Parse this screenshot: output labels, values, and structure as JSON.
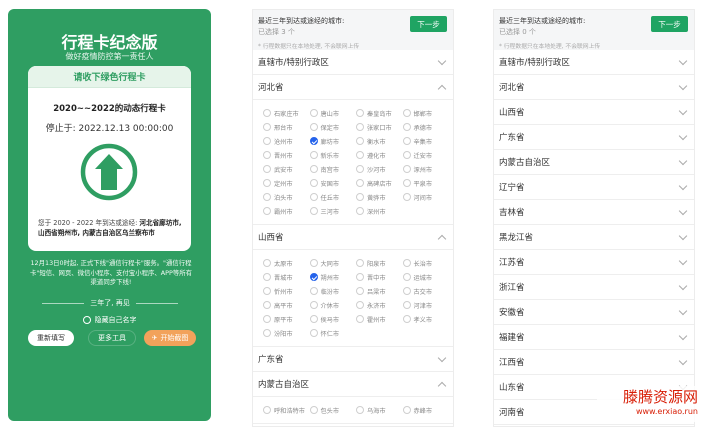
{
  "card": {
    "title": "行程卡纪念版",
    "subtitle": "做好疫情防控第一责任人",
    "inner_header": "请收下绿色行程卡",
    "inner_title": "2020~~2022的动态行程卡",
    "stop_text": "停止于: 2022.12.13 00:00:00",
    "info_prefix": "您于 2020 - 2022 年到达或途经: ",
    "info_places": "河北省廊坊市, 山西省朔州市, 内蒙古自治区乌兰察布市",
    "notice": "12月13日0时起, 正式下线\"通信行程卡\"服务。\"通信行程卡\"短信、网页、微信小程序、支付宝小程序、APP等所有渠道同步下线!",
    "divider": "三年了, 再见",
    "hide_name": "隐藏自己名字",
    "btn_rewrite": "重新填写",
    "btn_more": "更多工具",
    "btn_start": "开始截图",
    "accent": "#2f9e62"
  },
  "panel1": {
    "title": "最近三年到达或途经的城市:",
    "count": "已选择 3 个",
    "next": "下一步",
    "hint": "* 行程数据只在本地处理, 不会联网上传",
    "rows": [
      {
        "label": "直辖市/特别行政区",
        "open": false
      },
      {
        "label": "河北省",
        "open": true,
        "cities": [
          {
            "name": "石家庄市",
            "checked": false
          },
          {
            "name": "唐山市",
            "checked": false
          },
          {
            "name": "秦皇岛市",
            "checked": false
          },
          {
            "name": "邯郸市",
            "checked": false
          },
          {
            "name": "邢台市",
            "checked": false
          },
          {
            "name": "保定市",
            "checked": false
          },
          {
            "name": "张家口市",
            "checked": false
          },
          {
            "name": "承德市",
            "checked": false
          },
          {
            "name": "沧州市",
            "checked": false
          },
          {
            "name": "廊坊市",
            "checked": true
          },
          {
            "name": "衡水市",
            "checked": false
          },
          {
            "name": "辛集市",
            "checked": false
          },
          {
            "name": "晋州市",
            "checked": false
          },
          {
            "name": "新乐市",
            "checked": false
          },
          {
            "name": "遵化市",
            "checked": false
          },
          {
            "name": "迁安市",
            "checked": false
          },
          {
            "name": "武安市",
            "checked": false
          },
          {
            "name": "南宫市",
            "checked": false
          },
          {
            "name": "沙河市",
            "checked": false
          },
          {
            "name": "涿州市",
            "checked": false
          },
          {
            "name": "定州市",
            "checked": false
          },
          {
            "name": "安国市",
            "checked": false
          },
          {
            "name": "高碑店市",
            "checked": false
          },
          {
            "name": "平泉市",
            "checked": false
          },
          {
            "name": "泊头市",
            "checked": false
          },
          {
            "name": "任丘市",
            "checked": false
          },
          {
            "name": "黄骅市",
            "checked": false
          },
          {
            "name": "河间市",
            "checked": false
          },
          {
            "name": "霸州市",
            "checked": false
          },
          {
            "name": "三河市",
            "checked": false
          },
          {
            "name": "深州市",
            "checked": false
          }
        ]
      },
      {
        "label": "山西省",
        "open": true,
        "cities": [
          {
            "name": "太原市",
            "checked": false
          },
          {
            "name": "大同市",
            "checked": false
          },
          {
            "name": "阳泉市",
            "checked": false
          },
          {
            "name": "长治市",
            "checked": false
          },
          {
            "name": "晋城市",
            "checked": false
          },
          {
            "name": "朔州市",
            "checked": true
          },
          {
            "name": "晋中市",
            "checked": false
          },
          {
            "name": "运城市",
            "checked": false
          },
          {
            "name": "忻州市",
            "checked": false
          },
          {
            "name": "临汾市",
            "checked": false
          },
          {
            "name": "吕梁市",
            "checked": false
          },
          {
            "name": "古交市",
            "checked": false
          },
          {
            "name": "高平市",
            "checked": false
          },
          {
            "name": "介休市",
            "checked": false
          },
          {
            "name": "永济市",
            "checked": false
          },
          {
            "name": "河津市",
            "checked": false
          },
          {
            "name": "原平市",
            "checked": false
          },
          {
            "name": "侯马市",
            "checked": false
          },
          {
            "name": "霍州市",
            "checked": false
          },
          {
            "name": "孝义市",
            "checked": false
          },
          {
            "name": "汾阳市",
            "checked": false
          },
          {
            "name": "怀仁市",
            "checked": false
          }
        ]
      },
      {
        "label": "广东省",
        "open": false
      },
      {
        "label": "内蒙古自治区",
        "open": true,
        "cities": [
          {
            "name": "呼和浩特市",
            "checked": false
          },
          {
            "name": "包头市",
            "checked": false
          },
          {
            "name": "乌海市",
            "checked": false
          },
          {
            "name": "赤峰市",
            "checked": false
          }
        ]
      }
    ]
  },
  "panel2": {
    "title": "最近三年到达或途经的城市:",
    "count": "已选择 0 个",
    "next": "下一步",
    "hint": "* 行程数据只在本地处理, 不会联网上传",
    "rows": [
      {
        "label": "直辖市/特别行政区",
        "open": false
      },
      {
        "label": "河北省",
        "open": false
      },
      {
        "label": "山西省",
        "open": false
      },
      {
        "label": "广东省",
        "open": false
      },
      {
        "label": "内蒙古自治区",
        "open": false
      },
      {
        "label": "辽宁省",
        "open": false
      },
      {
        "label": "吉林省",
        "open": false
      },
      {
        "label": "黑龙江省",
        "open": false
      },
      {
        "label": "江苏省",
        "open": false
      },
      {
        "label": "浙江省",
        "open": false
      },
      {
        "label": "安徽省",
        "open": false
      },
      {
        "label": "福建省",
        "open": false
      },
      {
        "label": "江西省",
        "open": false
      },
      {
        "label": "山东省",
        "open": false
      },
      {
        "label": "河南省",
        "open": false
      }
    ]
  },
  "watermark": {
    "line1": "滕腾资源网",
    "line2": "www.erxiao.run"
  }
}
